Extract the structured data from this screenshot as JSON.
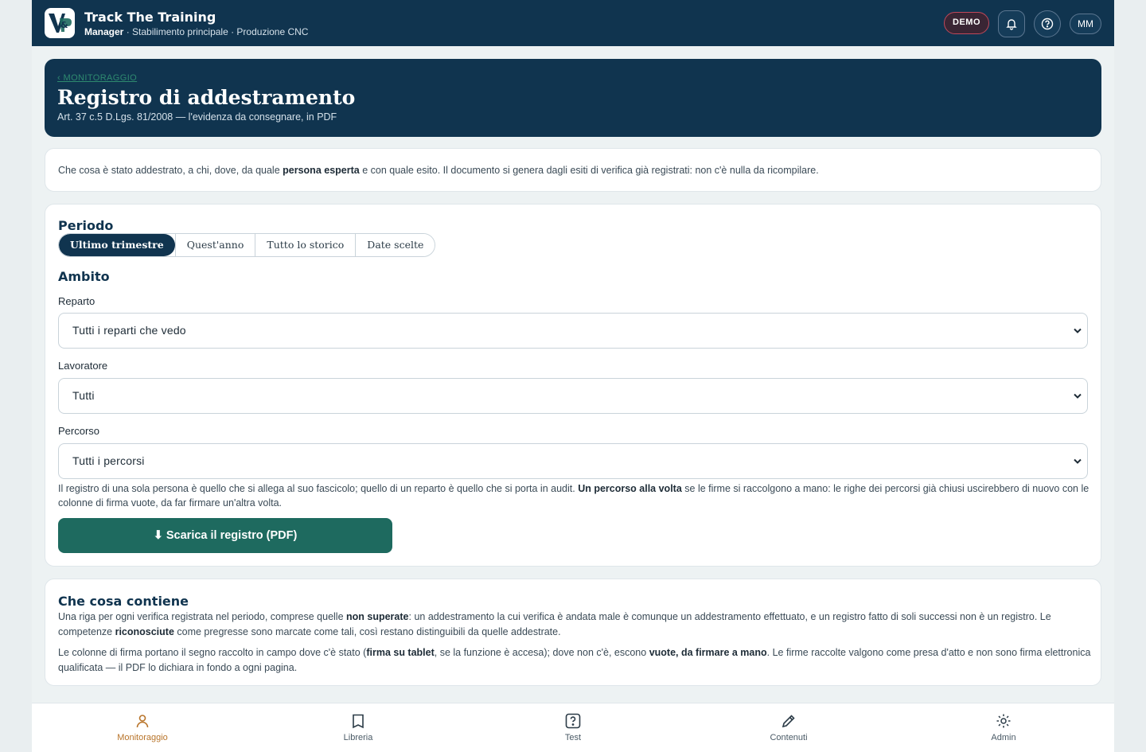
{
  "topbar": {
    "title": "Track The Training",
    "role": "Manager",
    "context": " · Stabilimento principale · Produzione CNC",
    "demo_badge": "DEMO",
    "avatar_initials": "MM"
  },
  "hero": {
    "breadcrumb": "‹ MONITORAGGIO",
    "title": "Registro di addestramento",
    "subtitle": "Art. 37 c.5 D.Lgs. 81/2008 — l'evidenza da consegnare, in PDF"
  },
  "intro": {
    "part1": "Che cosa è stato addestrato, a chi, dove, da quale ",
    "bold": "persona esperta",
    "part2": " e con quale esito. Il documento si genera dagli esiti di verifica già registrati: non c'è nulla da ricompilare."
  },
  "form": {
    "period_title": "Periodo",
    "period_options": [
      "Ultimo trimestre",
      "Quest'anno",
      "Tutto lo storico",
      "Date scelte"
    ],
    "scope_title": "Ambito",
    "department_label": "Reparto",
    "department_value": "Tutti i reparti che vedo",
    "worker_label": "Lavoratore",
    "worker_value": "Tutti",
    "path_label": "Percorso",
    "path_value": "Tutti i percorsi",
    "note_part1": "Il registro di una sola persona è quello che si allega al suo fascicolo; quello di un reparto è quello che si porta in audit. ",
    "note_bold": "Un percorso alla volta",
    "note_part2": " se le firme si raccolgono a mano: le righe dei percorsi già chiusi uscirebbero di nuovo con le colonne di firma vuote, da far firmare un'altra volta.",
    "download_label": "⬇ Scarica il registro (PDF)"
  },
  "contents": {
    "title": "Che cosa contiene",
    "p1_a": "Una riga per ogni verifica registrata nel periodo, comprese quelle ",
    "p1_b": "non superate",
    "p1_c": ": un addestramento la cui verifica è andata male è comunque un addestramento effettuato, e un registro fatto di soli successi non è un registro. Le competenze ",
    "p1_d": "riconosciute",
    "p1_e": " come pregresse sono marcate come tali, così restano distinguibili da quelle addestrate.",
    "p2_a": "Le colonne di firma portano il segno raccolto in campo dove c'è stato (",
    "p2_b": "firma su tablet",
    "p2_c": ", se la funzione è accesa); dove non c'è, escono ",
    "p2_d": "vuote, da firmare a mano",
    "p2_e": ". Le firme raccolte valgono come presa d'atto e non sono firma elettronica qualificata — il PDF lo dichiara in fondo a ogni pagina."
  },
  "nav": {
    "items": [
      {
        "label": "Monitoraggio",
        "icon": "person-icon"
      },
      {
        "label": "Libreria",
        "icon": "book-icon"
      },
      {
        "label": "Test",
        "icon": "question-icon"
      },
      {
        "label": "Contenuti",
        "icon": "pencil-icon"
      },
      {
        "label": "Admin",
        "icon": "gear-icon"
      }
    ]
  },
  "colors": {
    "navy": "#10344f",
    "green": "#1e6a5f",
    "accent": "#b8742a",
    "demo_border": "#c0485a"
  }
}
